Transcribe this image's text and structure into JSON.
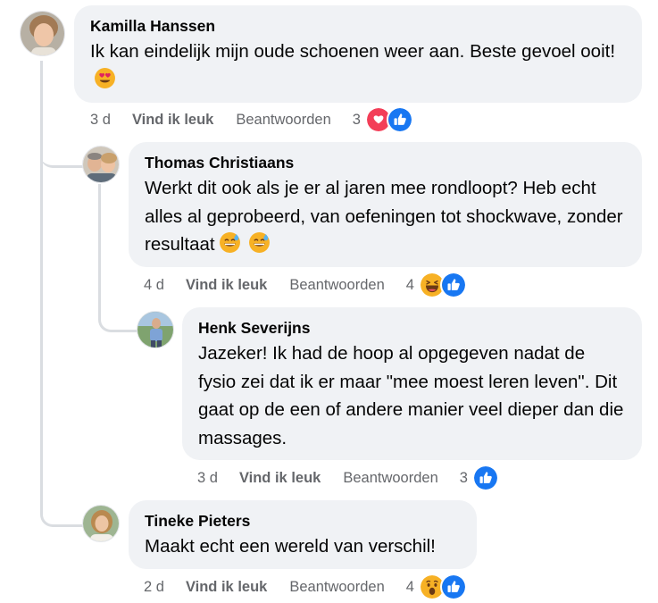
{
  "comments": [
    {
      "author": "Kamilla Hanssen",
      "text": "Ik kan eindelijk mijn oude schoenen weer aan. Beste gevoel ooit!",
      "emojis": [
        "heart-eyes"
      ],
      "time": "3 d",
      "like_label": "Vind ik leuk",
      "reply_label": "Beantwoorden",
      "reaction_count": "3",
      "reactions": [
        "love",
        "like"
      ]
    },
    {
      "author": "Thomas Christiaans",
      "text": "Werkt dit ook als je er al jaren mee rondloopt? Heb echt alles al geprobeerd, van oefeningen tot shockwave, zonder resultaat",
      "emojis": [
        "sweat-smile",
        "sweat-smile"
      ],
      "time": "4 d",
      "like_label": "Vind ik leuk",
      "reply_label": "Beantwoorden",
      "reaction_count": "4",
      "reactions": [
        "haha",
        "like"
      ]
    },
    {
      "author": "Henk Severijns",
      "text": "Jazeker! Ik had de hoop al opgegeven nadat de fysio zei dat ik er maar \"mee moest leren leven\". Dit gaat op de een of andere manier veel dieper dan die massages.",
      "emojis": [],
      "time": "3 d",
      "like_label": "Vind ik leuk",
      "reply_label": "Beantwoorden",
      "reaction_count": "3",
      "reactions": [
        "like"
      ]
    },
    {
      "author": "Tineke Pieters",
      "text": "Maakt echt een wereld van verschil!",
      "emojis": [],
      "time": "2 d",
      "like_label": "Vind ik leuk",
      "reply_label": "Beantwoorden",
      "reaction_count": "4",
      "reactions": [
        "wow",
        "like"
      ]
    }
  ],
  "colors": {
    "bubble": "#f0f2f5",
    "meta_text": "#65676b",
    "like_blue": "#1877f2",
    "love_red": "#f33e58",
    "emoji_yellow": "#f7b125",
    "thread_line": "#dadde1"
  }
}
